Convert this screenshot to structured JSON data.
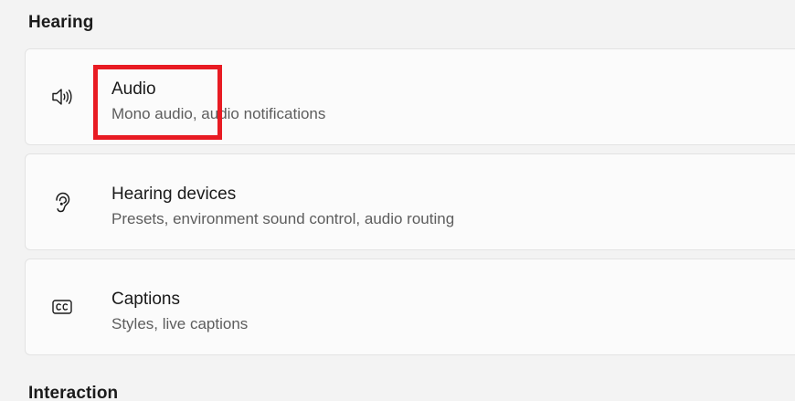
{
  "sections": {
    "hearing": "Hearing",
    "interaction": "Interaction"
  },
  "cards": {
    "audio": {
      "title": "Audio",
      "subtitle": "Mono audio, audio notifications",
      "icon": "speaker-icon"
    },
    "hearing_devices": {
      "title": "Hearing devices",
      "subtitle": "Presets, environment sound control, audio routing",
      "icon": "ear-icon"
    },
    "captions": {
      "title": "Captions",
      "subtitle": "Styles, live captions",
      "icon": "cc-icon"
    }
  },
  "colors": {
    "highlight": "#e81b23",
    "background": "#f3f3f3",
    "card": "#fbfbfb"
  }
}
